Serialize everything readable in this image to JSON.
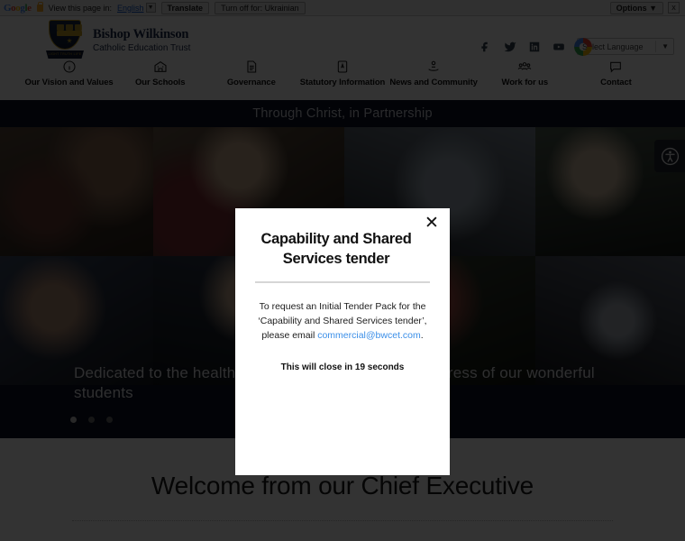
{
  "translate_bar": {
    "logo": "Google",
    "lock_icon": "lock-icon",
    "view_label": "View this page in:",
    "language_value": "English",
    "translate_button": "Translate",
    "turn_off_button": "Turn off for: Ukrainian",
    "options_button": "Options",
    "close_button": "x"
  },
  "header": {
    "brand_line1": "Bishop Wilkinson",
    "brand_line2": "Catholic Education Trust",
    "crest_ribbon": "LIGHT TRUTH LIFE",
    "social": [
      {
        "name": "facebook-icon",
        "label": "Facebook"
      },
      {
        "name": "twitter-icon",
        "label": "Twitter"
      },
      {
        "name": "linkedin-icon",
        "label": "LinkedIn"
      },
      {
        "name": "youtube-icon",
        "label": "YouTube"
      }
    ],
    "language_selector": {
      "label": "Select Language",
      "caret": "▼"
    },
    "nav": [
      {
        "label": "Our Vision and Values",
        "icon": "info-circle-icon"
      },
      {
        "label": "Our Schools",
        "icon": "school-building-icon"
      },
      {
        "label": "Governance",
        "icon": "document-icon"
      },
      {
        "label": "Statutory Information",
        "icon": "book-letter-icon"
      },
      {
        "label": "News and Community",
        "icon": "hand-person-icon"
      },
      {
        "label": "Work for us",
        "icon": "people-group-icon"
      },
      {
        "label": "Contact",
        "icon": "speech-bubble-icon"
      }
    ]
  },
  "banner": {
    "text": "Through Christ, in Partnership"
  },
  "hero": {
    "caption": "Dedicated to the health, wellbeing and academic progress of our wonderful students",
    "dots": 3,
    "active_dot": 0
  },
  "welcome": {
    "heading": "Welcome from our Chief Executive"
  },
  "accessibility": {
    "icon": "accessibility-person-icon"
  },
  "modal": {
    "title": "Capability and Shared Services tender",
    "close": "✕",
    "body_before": "To request an Initial Tender Pack for the ‘Capability and Shared Services tender’, please email ",
    "email": "commercial@bwcet.com",
    "body_after": ".",
    "timer": "This will close in 19 seconds"
  }
}
